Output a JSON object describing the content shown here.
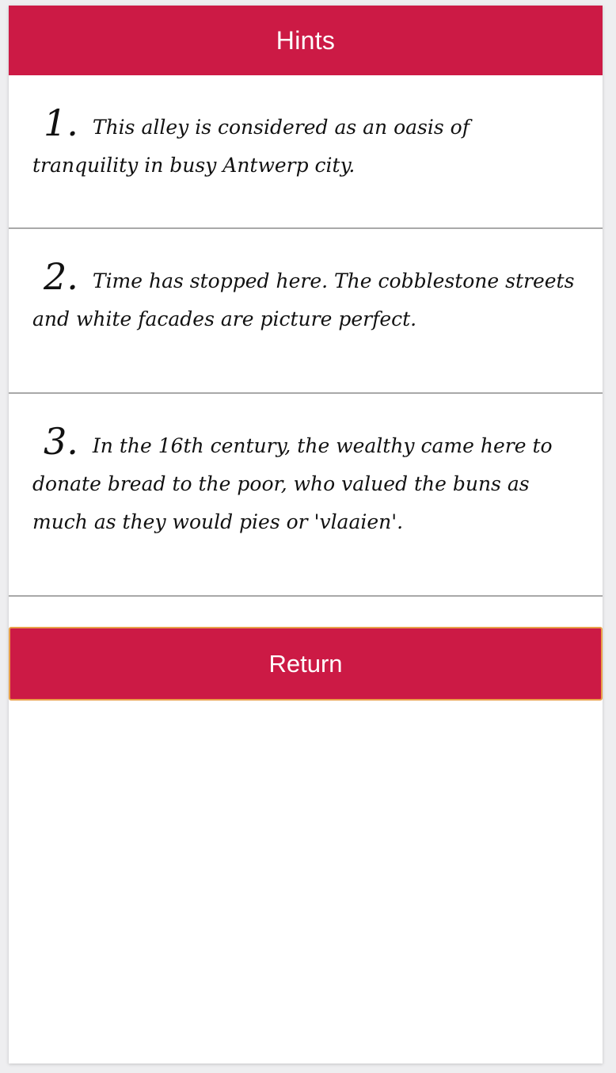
{
  "header": {
    "title": "Hints"
  },
  "hints": [
    {
      "number": "1.",
      "text": "This alley is considered as an oasis of tranquility in busy Antwerp city."
    },
    {
      "number": "2.",
      "text": "Time has stopped here. The cobblestone streets and white facades are picture perfect."
    },
    {
      "number": "3.",
      "text": "In the 16th century, the wealthy came here to donate bread to the poor, who valued the buns as much as they would pies or 'vlaaien'."
    }
  ],
  "actions": {
    "return_label": "Return"
  },
  "colors": {
    "accent": "#cc1a45",
    "button_border": "#e9a04a",
    "divider": "#a9a9a9"
  }
}
